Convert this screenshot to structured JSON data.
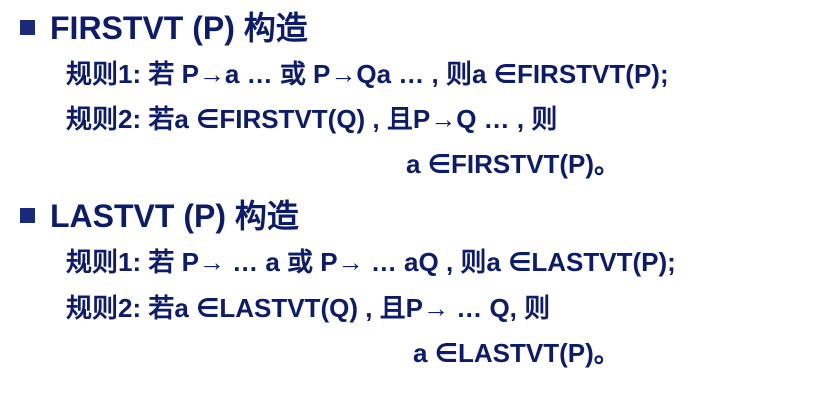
{
  "colors": {
    "heading_text": "#0d1b6b",
    "bullet": "#1a2a7a",
    "background": "#ffffff"
  },
  "sections": [
    {
      "heading": "FIRSTVT (P) 构造",
      "rules": [
        "规则1: 若 P→a …  或 P→Qa … , 则a ∈FIRSTVT(P);",
        "规则2: 若a ∈FIRSTVT(Q) , 且P→Q … , 则",
        "a ∈FIRSTVT(P)。"
      ]
    },
    {
      "heading": "LASTVT (P) 构造",
      "rules": [
        "规则1: 若 P→ … a 或 P→ … aQ , 则a ∈LASTVT(P);",
        "规则2: 若a ∈LASTVT(Q) , 且P→ … Q, 则",
        "a ∈LASTVT(P)。"
      ]
    }
  ]
}
